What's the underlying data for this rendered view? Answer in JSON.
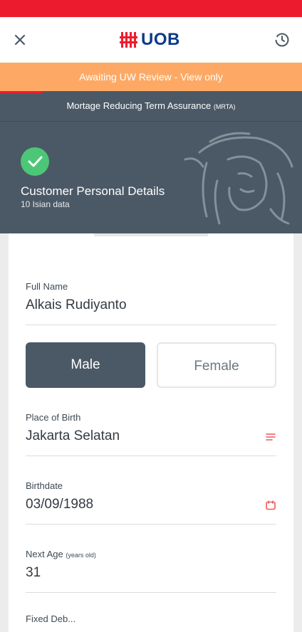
{
  "header": {
    "logo_text": "UOB",
    "close_icon": "close-icon",
    "history_icon": "history-icon"
  },
  "notice": {
    "text": "Awaiting UW Review - View only"
  },
  "product": {
    "name": "Mortage Reducing Term Assurance",
    "code": "(MRTA)"
  },
  "section": {
    "title": "Customer Personal Details",
    "subtitle": "10 Isian data",
    "status_icon": "check-icon"
  },
  "form": {
    "full_name": {
      "label": "Full Name",
      "value": "Alkais Rudiyanto"
    },
    "gender": {
      "options": [
        "Male",
        "Female"
      ],
      "selected": "Male"
    },
    "place_of_birth": {
      "label": "Place of Birth",
      "value": "Jakarta Selatan",
      "icon": "list-icon"
    },
    "birthdate": {
      "label": "Birthdate",
      "value": "03/09/1988",
      "icon": "calendar-icon"
    },
    "next_age": {
      "label": "Next Age",
      "unit": "(years old)",
      "value": "31"
    },
    "next_field_label": "Fixed Deb..."
  },
  "colors": {
    "brand_red": "#ec1c2e",
    "brand_blue": "#0b3a8c",
    "notice_orange": "#fda965",
    "hero_slate": "#4b5966",
    "success_green": "#4cc777"
  }
}
